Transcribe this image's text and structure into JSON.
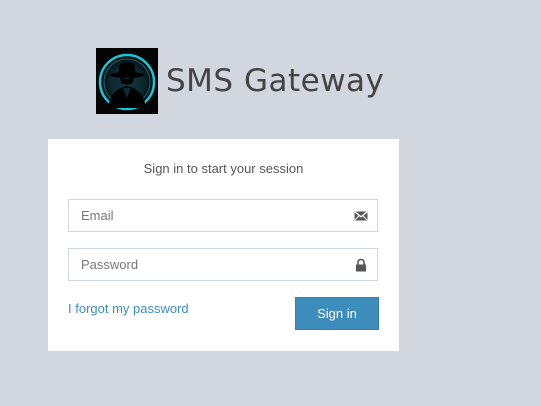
{
  "header": {
    "logo_icon": "spy-silhouette-logo",
    "title": "SMS Gateway"
  },
  "login": {
    "message": "Sign in to start your session",
    "email": {
      "placeholder": "Email",
      "value": "",
      "icon": "envelope-icon"
    },
    "password": {
      "placeholder": "Password",
      "value": "",
      "icon": "lock-icon"
    },
    "forgot_label": "I forgot my password",
    "signin_label": "Sign in"
  },
  "colors": {
    "page_background": "#d2d6de",
    "box_background": "#ffffff",
    "accent": "#3c8dbc",
    "link": "#3c8dbc",
    "logo_glow": "#19c6d8"
  }
}
